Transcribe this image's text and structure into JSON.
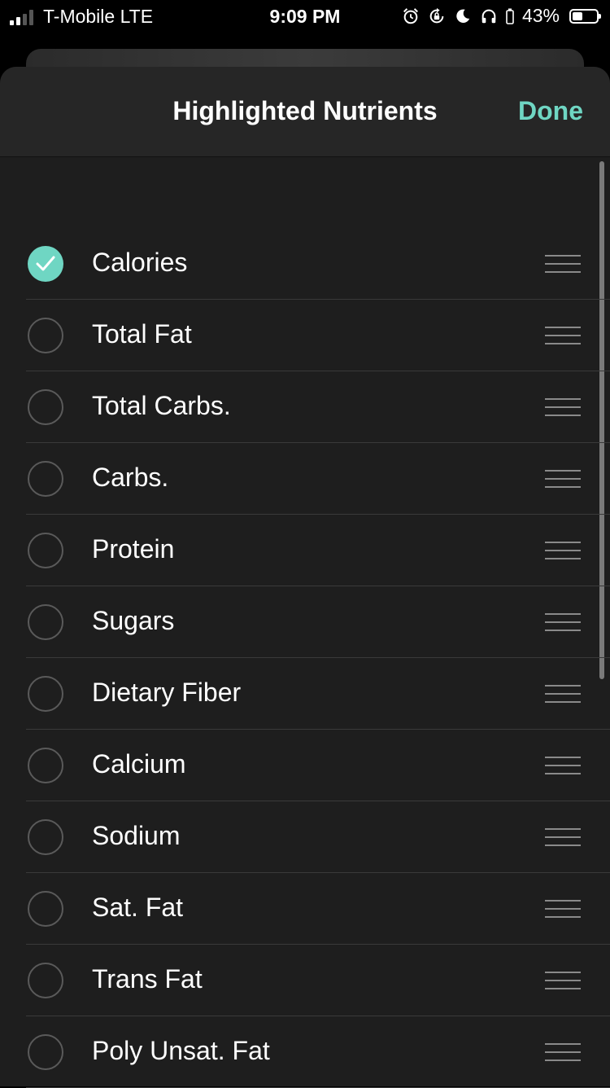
{
  "status_bar": {
    "carrier": "T-Mobile LTE",
    "time": "9:09 PM",
    "battery_percent": "43%",
    "battery_level": 0.43,
    "icons": [
      "alarm-icon",
      "rotation-lock-icon",
      "moon-icon",
      "headphones-icon"
    ]
  },
  "nav": {
    "title": "Highlighted Nutrients",
    "done_label": "Done"
  },
  "colors": {
    "accent": "#6fd6c3",
    "sheet_background": "#1e1e1e",
    "nav_background": "#262626"
  },
  "nutrients": [
    {
      "label": "Calories",
      "checked": true
    },
    {
      "label": "Total Fat",
      "checked": false
    },
    {
      "label": "Total Carbs.",
      "checked": false
    },
    {
      "label": "Carbs.",
      "checked": false
    },
    {
      "label": "Protein",
      "checked": false
    },
    {
      "label": "Sugars",
      "checked": false
    },
    {
      "label": "Dietary Fiber",
      "checked": false
    },
    {
      "label": "Calcium",
      "checked": false
    },
    {
      "label": "Sodium",
      "checked": false
    },
    {
      "label": "Sat. Fat",
      "checked": false
    },
    {
      "label": "Trans Fat",
      "checked": false
    },
    {
      "label": "Poly Unsat. Fat",
      "checked": false
    }
  ]
}
